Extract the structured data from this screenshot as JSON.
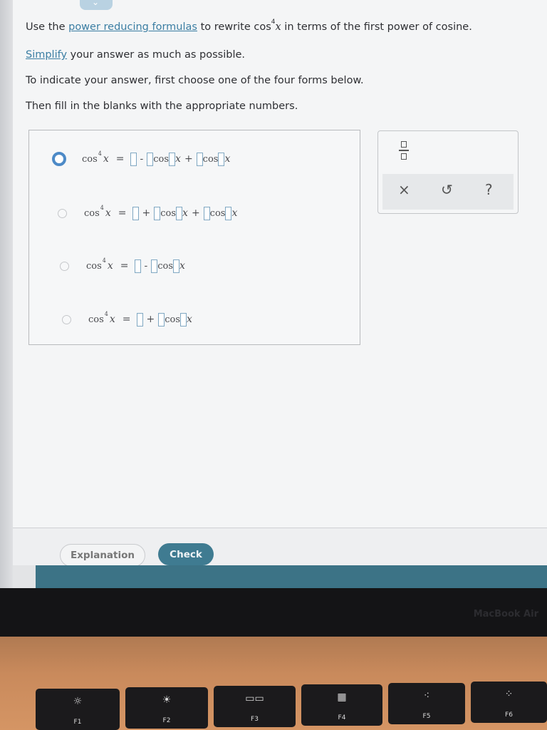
{
  "instructions": {
    "line1_pre": "Use the ",
    "line1_link": "power reducing formulas",
    "line1_mid": " to rewrite cos",
    "line1_sup": "4",
    "line1_var": "x",
    "line1_post": " in terms of the first power of cosine.",
    "line2_link": "Simplify",
    "line2_post": " your answer as much as possible.",
    "line3": "To indicate your answer, first choose one of the four forms below.",
    "line4": "Then fill in the blanks with the appropriate numbers."
  },
  "choices": {
    "selected_index": 0,
    "cos": "cos",
    "power": "4",
    "var": "x",
    "equals": "=",
    "minus": "-",
    "plus": "+"
  },
  "toolbox": {
    "clear_symbol": "×",
    "undo_symbol": "↺",
    "help_symbol": "?"
  },
  "footer": {
    "explanation_label": "Explanation",
    "check_label": "Check"
  },
  "device": {
    "brand": "MacBook Air"
  },
  "keyboard": {
    "keys": [
      {
        "label": "F1",
        "icon": "☼"
      },
      {
        "label": "F2",
        "icon": "☀"
      },
      {
        "label": "F3",
        "icon": "▭▭"
      },
      {
        "label": "F4",
        "icon": "▦"
      },
      {
        "label": "F5",
        "icon": "⁖"
      },
      {
        "label": "F6",
        "icon": "⁘"
      }
    ]
  }
}
